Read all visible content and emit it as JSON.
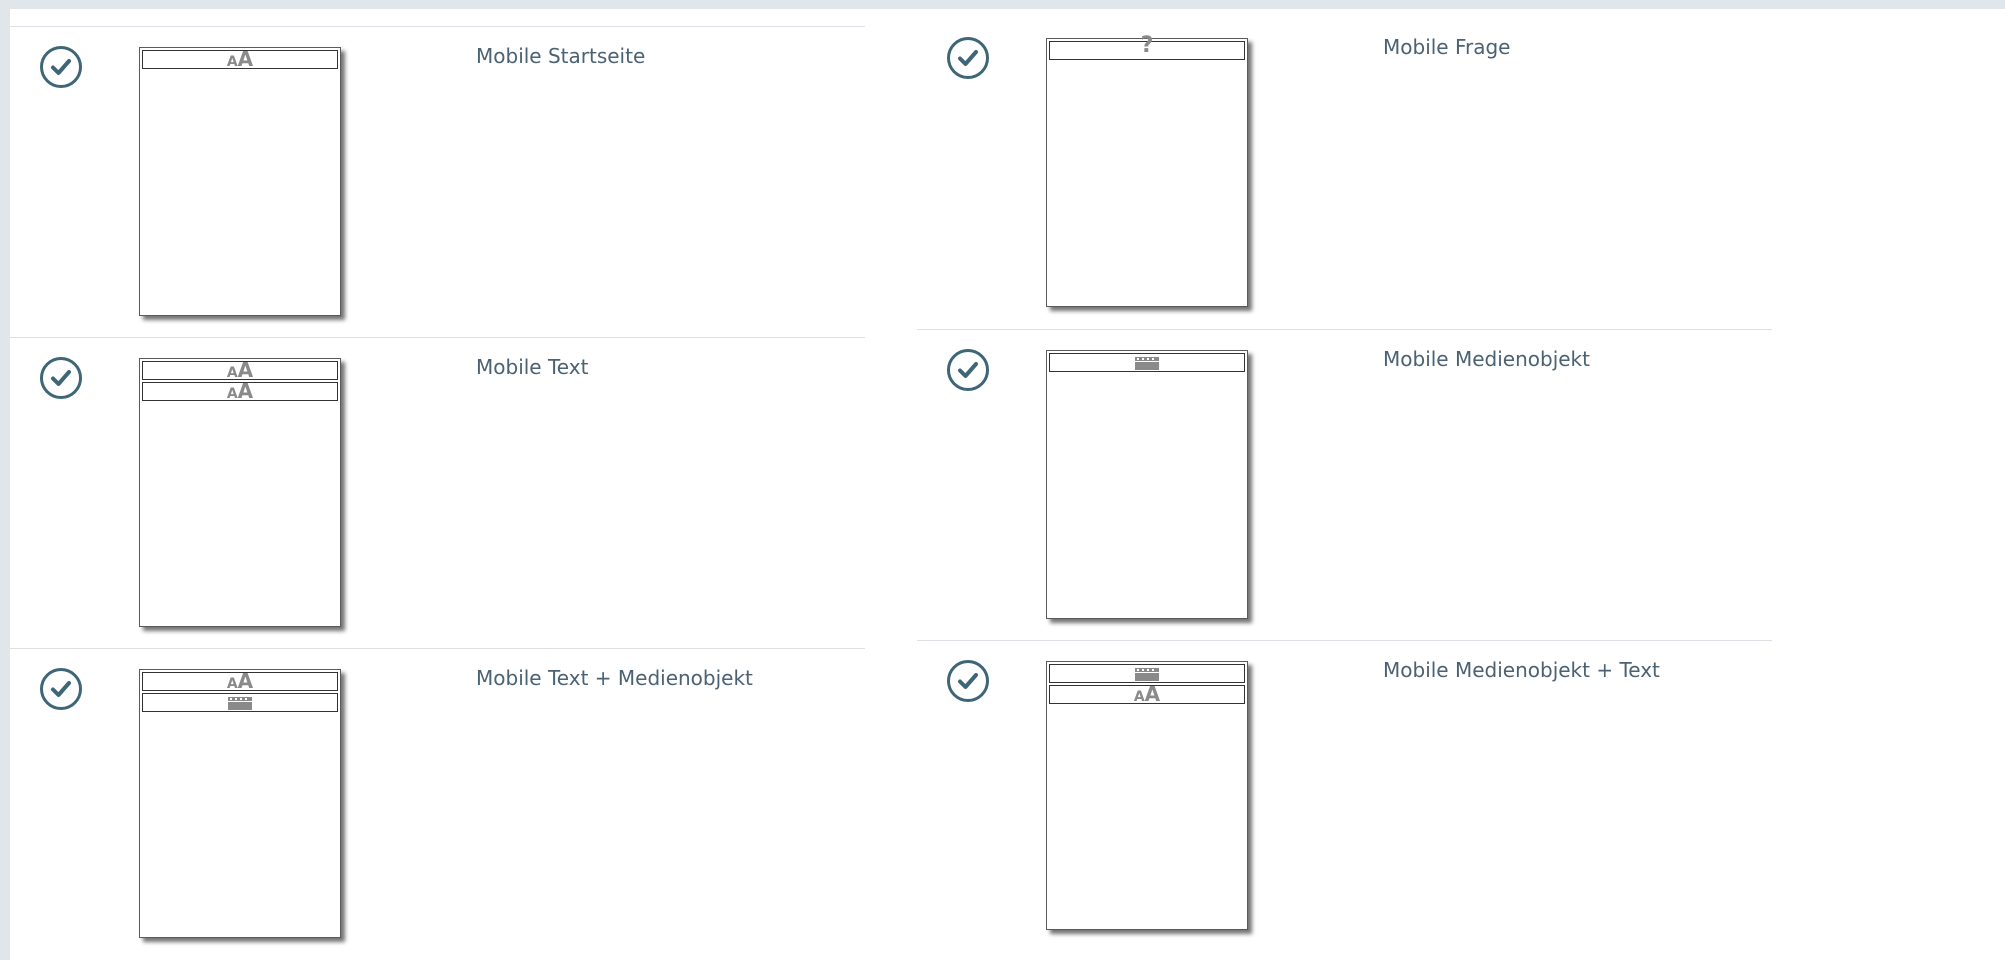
{
  "layouts": [
    {
      "label": "Mobile Startseite",
      "slots": [
        "text"
      ]
    },
    {
      "label": "Mobile Frage",
      "slots": [
        "question"
      ]
    },
    {
      "label": "Mobile Text",
      "slots": [
        "text",
        "text"
      ]
    },
    {
      "label": "Mobile Medienobjekt",
      "slots": [
        "media"
      ]
    },
    {
      "label": "Mobile Text + Medienobjekt",
      "slots": [
        "text",
        "media"
      ]
    },
    {
      "label": "Mobile Medienobjekt + Text",
      "slots": [
        "media",
        "text"
      ]
    }
  ],
  "glyphs": {
    "text_small": "A",
    "text_big": "A",
    "question": "?"
  },
  "colors": {
    "accent": "#3e6677",
    "label": "#4a6273",
    "background": "#e1e6ea",
    "divider": "#dde1e5"
  },
  "icons": {
    "selected": "check-circle-icon",
    "text_slot": "font-size-icon",
    "media_slot": "film-icon",
    "question_slot": "question-mark-icon"
  }
}
